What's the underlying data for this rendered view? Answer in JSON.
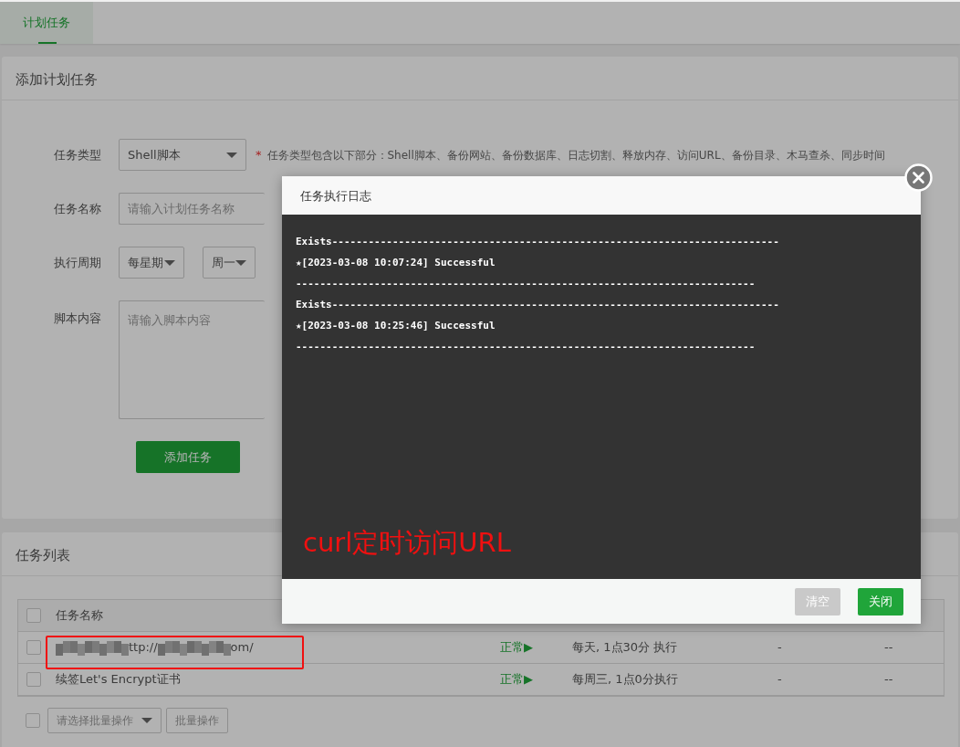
{
  "tabs": [
    {
      "label": "计划任务",
      "selected": true
    }
  ],
  "add_form": {
    "title": "添加计划任务",
    "fields": [
      {
        "kind": "select",
        "label": "任务类型",
        "value": "Shell脚本",
        "required_mark": "*",
        "note": "任务类型包含以下部分：Shell脚本、备份网站、备份数据库、日志切割、释放内存、访问URL、备份目录、木马查杀、同步时间"
      },
      {
        "kind": "input",
        "label": "任务名称",
        "placeholder": "请输入计划任务名称"
      },
      {
        "kind": "selects",
        "label": "执行周期",
        "values": [
          "每星期",
          "周一"
        ]
      },
      {
        "kind": "textarea",
        "label": "脚本内容",
        "placeholder": "请输入脚本内容"
      }
    ],
    "submit": "添加任务"
  },
  "task_list": {
    "title": "任务列表",
    "select_all_checked": false,
    "columns": [
      "任务名称"
    ],
    "rows": [
      {
        "checked": false,
        "annotated": true,
        "name": [
          {
            "kind": "redacted"
          },
          {
            "kind": "text",
            "text": "ttp://"
          },
          {
            "kind": "redacted"
          },
          {
            "kind": "text",
            "text": "om/"
          }
        ],
        "status": "正常▶",
        "schedule": "每天, 1点30分 执行",
        "column_4": "-",
        "column_5": "--"
      },
      {
        "checked": false,
        "annotated": false,
        "name": [
          {
            "kind": "text",
            "text": "续签Let's Encrypt证书"
          }
        ],
        "status": "正常▶",
        "schedule": "每周三, 1点0分执行",
        "column_4": "-",
        "column_5": "--"
      }
    ],
    "batch_checked": false,
    "batch_placeholder": "请选择批量操作",
    "batch_button": "批量操作"
  },
  "modal": {
    "title": "任务执行日志",
    "log": [
      "Exists--------------------------------------------------------------------------",
      "★[2023-03-08 10:07:24] Successful",
      "----------------------------------------------------------------------------",
      "Exists--------------------------------------------------------------------------",
      "★[2023-03-08 10:25:46] Successful",
      "----------------------------------------------------------------------------"
    ],
    "annotation": "curl定时访问URL",
    "buttons": [
      {
        "label": "清空",
        "kind": "secondary"
      },
      {
        "label": "关闭",
        "kind": "primary"
      }
    ]
  }
}
